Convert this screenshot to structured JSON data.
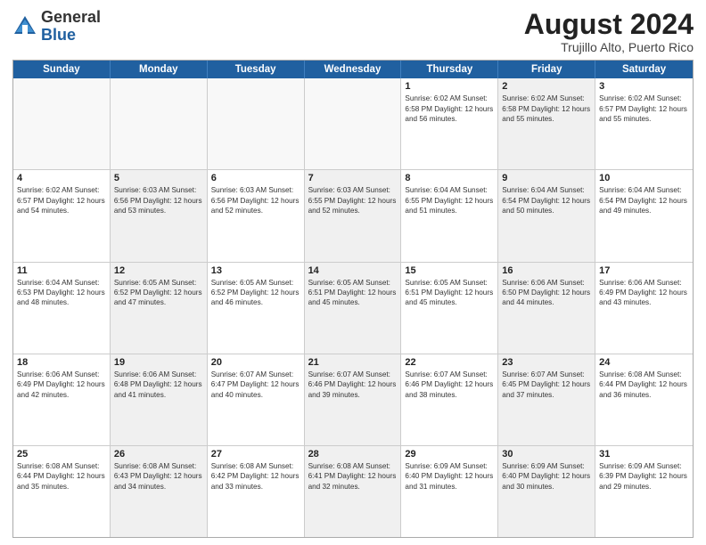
{
  "header": {
    "logo_general": "General",
    "logo_blue": "Blue",
    "main_title": "August 2024",
    "subtitle": "Trujillo Alto, Puerto Rico"
  },
  "days_of_week": [
    "Sunday",
    "Monday",
    "Tuesday",
    "Wednesday",
    "Thursday",
    "Friday",
    "Saturday"
  ],
  "weeks": [
    [
      {
        "day": "",
        "info": "",
        "empty": true
      },
      {
        "day": "",
        "info": "",
        "empty": true
      },
      {
        "day": "",
        "info": "",
        "empty": true
      },
      {
        "day": "",
        "info": "",
        "empty": true
      },
      {
        "day": "1",
        "info": "Sunrise: 6:02 AM\nSunset: 6:58 PM\nDaylight: 12 hours\nand 56 minutes."
      },
      {
        "day": "2",
        "info": "Sunrise: 6:02 AM\nSunset: 6:58 PM\nDaylight: 12 hours\nand 55 minutes.",
        "shaded": true
      },
      {
        "day": "3",
        "info": "Sunrise: 6:02 AM\nSunset: 6:57 PM\nDaylight: 12 hours\nand 55 minutes."
      }
    ],
    [
      {
        "day": "4",
        "info": "Sunrise: 6:02 AM\nSunset: 6:57 PM\nDaylight: 12 hours\nand 54 minutes."
      },
      {
        "day": "5",
        "info": "Sunrise: 6:03 AM\nSunset: 6:56 PM\nDaylight: 12 hours\nand 53 minutes.",
        "shaded": true
      },
      {
        "day": "6",
        "info": "Sunrise: 6:03 AM\nSunset: 6:56 PM\nDaylight: 12 hours\nand 52 minutes."
      },
      {
        "day": "7",
        "info": "Sunrise: 6:03 AM\nSunset: 6:55 PM\nDaylight: 12 hours\nand 52 minutes.",
        "shaded": true
      },
      {
        "day": "8",
        "info": "Sunrise: 6:04 AM\nSunset: 6:55 PM\nDaylight: 12 hours\nand 51 minutes."
      },
      {
        "day": "9",
        "info": "Sunrise: 6:04 AM\nSunset: 6:54 PM\nDaylight: 12 hours\nand 50 minutes.",
        "shaded": true
      },
      {
        "day": "10",
        "info": "Sunrise: 6:04 AM\nSunset: 6:54 PM\nDaylight: 12 hours\nand 49 minutes."
      }
    ],
    [
      {
        "day": "11",
        "info": "Sunrise: 6:04 AM\nSunset: 6:53 PM\nDaylight: 12 hours\nand 48 minutes."
      },
      {
        "day": "12",
        "info": "Sunrise: 6:05 AM\nSunset: 6:52 PM\nDaylight: 12 hours\nand 47 minutes.",
        "shaded": true
      },
      {
        "day": "13",
        "info": "Sunrise: 6:05 AM\nSunset: 6:52 PM\nDaylight: 12 hours\nand 46 minutes."
      },
      {
        "day": "14",
        "info": "Sunrise: 6:05 AM\nSunset: 6:51 PM\nDaylight: 12 hours\nand 45 minutes.",
        "shaded": true
      },
      {
        "day": "15",
        "info": "Sunrise: 6:05 AM\nSunset: 6:51 PM\nDaylight: 12 hours\nand 45 minutes."
      },
      {
        "day": "16",
        "info": "Sunrise: 6:06 AM\nSunset: 6:50 PM\nDaylight: 12 hours\nand 44 minutes.",
        "shaded": true
      },
      {
        "day": "17",
        "info": "Sunrise: 6:06 AM\nSunset: 6:49 PM\nDaylight: 12 hours\nand 43 minutes."
      }
    ],
    [
      {
        "day": "18",
        "info": "Sunrise: 6:06 AM\nSunset: 6:49 PM\nDaylight: 12 hours\nand 42 minutes."
      },
      {
        "day": "19",
        "info": "Sunrise: 6:06 AM\nSunset: 6:48 PM\nDaylight: 12 hours\nand 41 minutes.",
        "shaded": true
      },
      {
        "day": "20",
        "info": "Sunrise: 6:07 AM\nSunset: 6:47 PM\nDaylight: 12 hours\nand 40 minutes."
      },
      {
        "day": "21",
        "info": "Sunrise: 6:07 AM\nSunset: 6:46 PM\nDaylight: 12 hours\nand 39 minutes.",
        "shaded": true
      },
      {
        "day": "22",
        "info": "Sunrise: 6:07 AM\nSunset: 6:46 PM\nDaylight: 12 hours\nand 38 minutes."
      },
      {
        "day": "23",
        "info": "Sunrise: 6:07 AM\nSunset: 6:45 PM\nDaylight: 12 hours\nand 37 minutes.",
        "shaded": true
      },
      {
        "day": "24",
        "info": "Sunrise: 6:08 AM\nSunset: 6:44 PM\nDaylight: 12 hours\nand 36 minutes."
      }
    ],
    [
      {
        "day": "25",
        "info": "Sunrise: 6:08 AM\nSunset: 6:44 PM\nDaylight: 12 hours\nand 35 minutes."
      },
      {
        "day": "26",
        "info": "Sunrise: 6:08 AM\nSunset: 6:43 PM\nDaylight: 12 hours\nand 34 minutes.",
        "shaded": true
      },
      {
        "day": "27",
        "info": "Sunrise: 6:08 AM\nSunset: 6:42 PM\nDaylight: 12 hours\nand 33 minutes."
      },
      {
        "day": "28",
        "info": "Sunrise: 6:08 AM\nSunset: 6:41 PM\nDaylight: 12 hours\nand 32 minutes.",
        "shaded": true
      },
      {
        "day": "29",
        "info": "Sunrise: 6:09 AM\nSunset: 6:40 PM\nDaylight: 12 hours\nand 31 minutes."
      },
      {
        "day": "30",
        "info": "Sunrise: 6:09 AM\nSunset: 6:40 PM\nDaylight: 12 hours\nand 30 minutes.",
        "shaded": true
      },
      {
        "day": "31",
        "info": "Sunrise: 6:09 AM\nSunset: 6:39 PM\nDaylight: 12 hours\nand 29 minutes."
      }
    ]
  ]
}
